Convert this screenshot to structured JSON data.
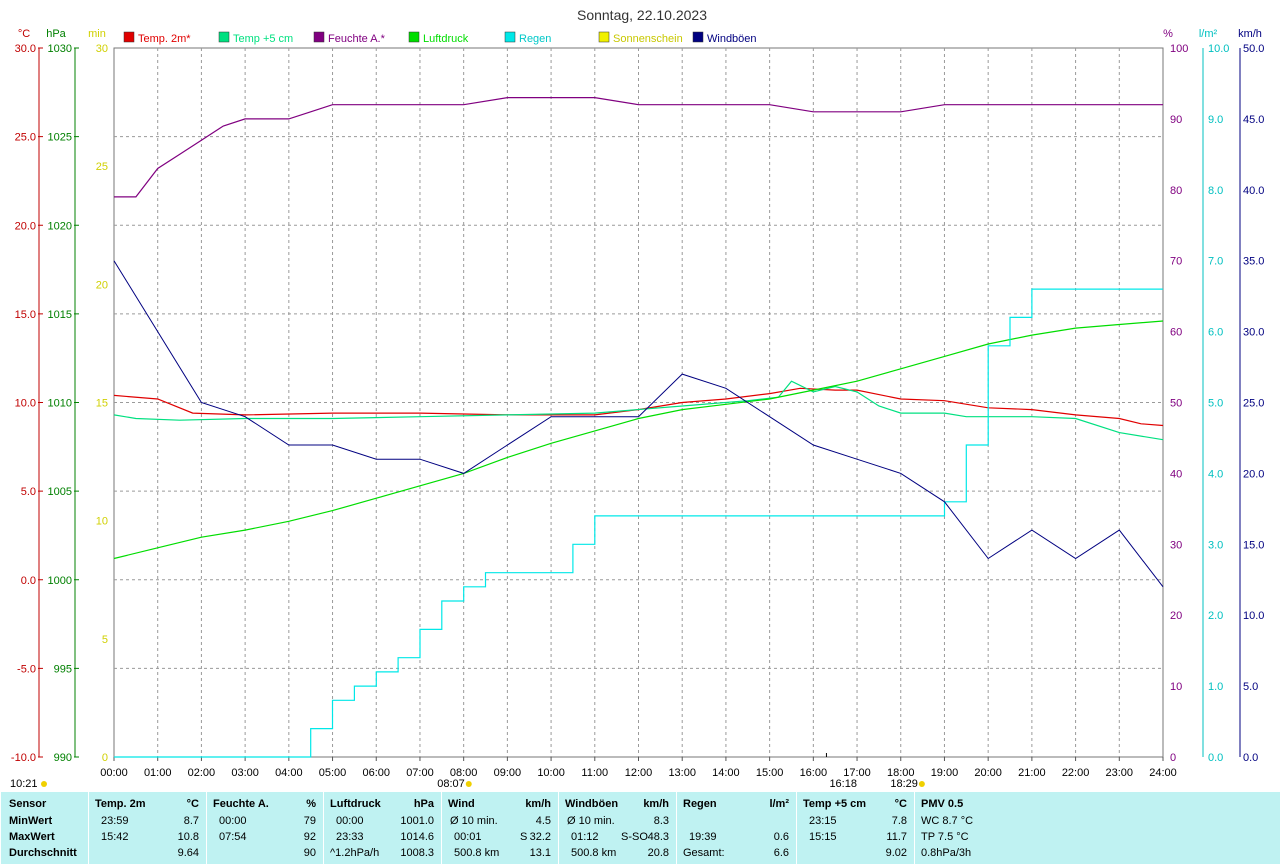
{
  "chart_data": {
    "type": "line",
    "title": "Sonntag, 22.10.2023",
    "legend": [
      {
        "label": "Temp. 2m*",
        "color": "#e00000"
      },
      {
        "label": "Temp +5 cm",
        "color": "#00e080"
      },
      {
        "label": "Feuchte A.*",
        "color": "#800080"
      },
      {
        "label": "Luftdruck",
        "color": "#00dd00"
      },
      {
        "label": "Regen",
        "color": "#00e8e8"
      },
      {
        "label": "Sonnenschein",
        "color": "#f0f000"
      },
      {
        "label": "Windböen",
        "color": "#000080"
      }
    ],
    "axis_units": {
      "temp": "°C",
      "pressure": "hPa",
      "sun": "min",
      "humidity": "%",
      "rain": "l/m²",
      "wind": "km/h"
    },
    "temp_axis": {
      "min": -10,
      "max": 30,
      "ticks": [
        "30.0",
        "25.0",
        "20.0",
        "15.0",
        "10.0",
        "5.0",
        "0.0",
        "-5.0",
        "-10.0"
      ]
    },
    "pressure_axis": {
      "min": 990,
      "max": 1030,
      "ticks": [
        "1030",
        "1025",
        "1020",
        "1015",
        "1010",
        "1005",
        "1000",
        "995",
        "990"
      ]
    },
    "sun_axis": {
      "min": 0,
      "max": 30,
      "ticks": [
        "30",
        "25",
        "20",
        "15",
        "10",
        "5",
        "0"
      ]
    },
    "humidity_axis": {
      "min": 0,
      "max": 100,
      "ticks": [
        "100",
        "90",
        "80",
        "70",
        "60",
        "50",
        "40",
        "30",
        "20",
        "10",
        "0"
      ]
    },
    "rain_axis": {
      "min": 0,
      "max": 10,
      "ticks": [
        "10.0",
        "9.0",
        "8.0",
        "7.0",
        "6.0",
        "5.0",
        "4.0",
        "3.0",
        "2.0",
        "1.0",
        "0.0"
      ]
    },
    "wind_axis": {
      "min": 0,
      "max": 50,
      "ticks": [
        "50.0",
        "45.0",
        "40.0",
        "35.0",
        "30.0",
        "25.0",
        "20.0",
        "15.0",
        "10.0",
        "5.0",
        "0.0"
      ]
    },
    "x_ticks": [
      "00:00",
      "01:00",
      "02:00",
      "03:00",
      "04:00",
      "05:00",
      "06:00",
      "07:00",
      "08:00",
      "09:00",
      "10:00",
      "11:00",
      "12:00",
      "13:00",
      "14:00",
      "15:00",
      "16:00",
      "17:00",
      "18:00",
      "19:00",
      "20:00",
      "21:00",
      "22:00",
      "23:00",
      "24:00"
    ],
    "sunrise_label": "08:07",
    "sunset_label": "18:29",
    "solar_noon_label": "16:18",
    "time_corner_label": "10:21",
    "series": [
      {
        "name": "Temp. 2m*",
        "axis": "temp",
        "x": [
          0,
          1,
          1.8,
          3,
          5,
          7,
          9,
          11,
          12,
          13,
          14,
          15,
          15.7,
          16.5,
          17,
          18,
          19,
          20,
          21,
          22,
          23,
          23.5,
          24
        ],
        "y": [
          10.4,
          10.2,
          9.4,
          9.3,
          9.4,
          9.4,
          9.3,
          9.3,
          9.6,
          10.0,
          10.2,
          10.5,
          10.8,
          10.7,
          10.7,
          10.2,
          10.1,
          9.7,
          9.6,
          9.3,
          9.1,
          8.8,
          8.7
        ]
      },
      {
        "name": "Temp +5 cm",
        "axis": "temp",
        "x": [
          0,
          0.5,
          1.5,
          3,
          5,
          7,
          9,
          11,
          13,
          14.5,
          15.2,
          15.5,
          16,
          16.5,
          17,
          17.5,
          18,
          19,
          19.5,
          20,
          21,
          22,
          23,
          24
        ],
        "y": [
          9.3,
          9.1,
          9.0,
          9.1,
          9.1,
          9.2,
          9.3,
          9.4,
          9.8,
          10.1,
          10.3,
          11.2,
          10.6,
          10.9,
          10.6,
          9.8,
          9.4,
          9.4,
          9.2,
          9.2,
          9.2,
          9.1,
          8.3,
          7.9
        ]
      },
      {
        "name": "Feuchte A.*",
        "axis": "humidity",
        "x": [
          0,
          0.5,
          1,
          1.5,
          2,
          2.5,
          3,
          4,
          4.5,
          5,
          6,
          7,
          8,
          9,
          10,
          11,
          12,
          13,
          14,
          15,
          16,
          17,
          18,
          19,
          20,
          21,
          22,
          23,
          24
        ],
        "y": [
          79,
          79,
          83,
          85,
          87,
          89,
          90,
          90,
          91,
          92,
          92,
          92,
          92,
          93,
          93,
          93,
          92,
          92,
          92,
          92,
          91,
          91,
          91,
          92,
          92,
          92,
          92,
          92,
          92
        ]
      },
      {
        "name": "Luftdruck",
        "axis": "pressure",
        "x": [
          0,
          1,
          2,
          3,
          4,
          5,
          6,
          7,
          8,
          9,
          10,
          11,
          12,
          13,
          14,
          15,
          16,
          17,
          18,
          19,
          20,
          21,
          22,
          23,
          24
        ],
        "y": [
          1001.2,
          1001.8,
          1002.4,
          1002.8,
          1003.3,
          1003.9,
          1004.6,
          1005.3,
          1006.0,
          1006.9,
          1007.7,
          1008.4,
          1009.1,
          1009.6,
          1009.9,
          1010.2,
          1010.7,
          1011.2,
          1011.9,
          1012.6,
          1013.3,
          1013.8,
          1014.2,
          1014.4,
          1014.6
        ]
      },
      {
        "name": "Regen",
        "axis": "rain",
        "x": [
          0,
          4,
          4.5,
          5,
          5.5,
          6,
          6.5,
          7,
          7.5,
          8,
          8.5,
          9,
          10,
          10.5,
          11,
          12,
          14,
          15,
          16,
          17,
          18,
          19,
          19.5,
          20,
          20.5,
          21,
          22,
          23,
          24
        ],
        "y": [
          0,
          0,
          0.4,
          0.8,
          1.0,
          1.2,
          1.4,
          1.8,
          2.2,
          2.4,
          2.6,
          2.6,
          2.6,
          3.0,
          3.4,
          3.4,
          3.4,
          3.4,
          3.4,
          3.4,
          3.4,
          3.6,
          4.4,
          5.8,
          6.2,
          6.6,
          6.6,
          6.6,
          6.6
        ]
      },
      {
        "name": "Windböen",
        "axis": "wind",
        "x": [
          0,
          1,
          2,
          3,
          4,
          5,
          6,
          7,
          8,
          9,
          10,
          11,
          12,
          13,
          14,
          15,
          16,
          17,
          18,
          19,
          20,
          21,
          22,
          23,
          24
        ],
        "y": [
          35,
          30,
          25,
          24,
          22,
          22,
          21,
          21,
          20,
          22,
          24,
          24,
          24,
          27,
          26,
          24,
          22,
          21,
          20,
          18,
          14,
          16,
          14,
          16,
          12
        ]
      }
    ],
    "legend_placement": "top",
    "grid": true
  },
  "stats": {
    "col1": {
      "title": "Sensor",
      "rows": [
        "MinWert",
        "MaxWert",
        "Durchschnitt"
      ]
    },
    "col2": {
      "title": "Temp. 2m",
      "unit": "°C",
      "r1a": "23:59",
      "r1b": "8.7",
      "r2a": "15:42",
      "r2b": "10.8",
      "r3b": "9.64"
    },
    "col3": {
      "title": "Feuchte A.",
      "unit": "%",
      "r1a": "00:00",
      "r1b": "79",
      "r2a": "07:54",
      "r2b": "92",
      "r3b": "90"
    },
    "col4": {
      "title": "Luftdruck",
      "unit": "hPa",
      "r1a": "00:00",
      "r1b": "1001.0",
      "r2a": "23:33",
      "r2b": "1014.6",
      "r3a": "^1.2hPa/h",
      "r3b": "1008.3"
    },
    "col5": {
      "title": "Wind",
      "unit": "km/h",
      "r1a": "Ø 10 min.",
      "r1b": "4.5",
      "r2a": "00:01",
      "r2c": "S",
      "r2b": "32.2",
      "r3a": "500.8 km",
      "r3b": "13.1"
    },
    "col6": {
      "title": "Windböen",
      "unit": "km/h",
      "r1a": "Ø 10 min.",
      "r1b": "8.3",
      "r2a": "01:12",
      "r2c": "S-SO",
      "r2b": "48.3",
      "r3a": "500.8 km",
      "r3b": "20.8"
    },
    "col7": {
      "title": "Regen",
      "unit": "l/m²",
      "r2a": "19:39",
      "r2b": "0.6",
      "r3a": "Gesamt:",
      "r3b": "6.6"
    },
    "col8": {
      "title": "Temp +5 cm",
      "unit": "°C",
      "r1a": "23:15",
      "r1b": "7.8",
      "r2a": "15:15",
      "r2b": "11.7",
      "r3b": "9.02"
    },
    "col9": {
      "title": "PMV 0.5",
      "r1a": "WC 8.7 °C",
      "r2a": "TP 7.5 °C",
      "r3a": "0.8hPa/3h"
    }
  }
}
